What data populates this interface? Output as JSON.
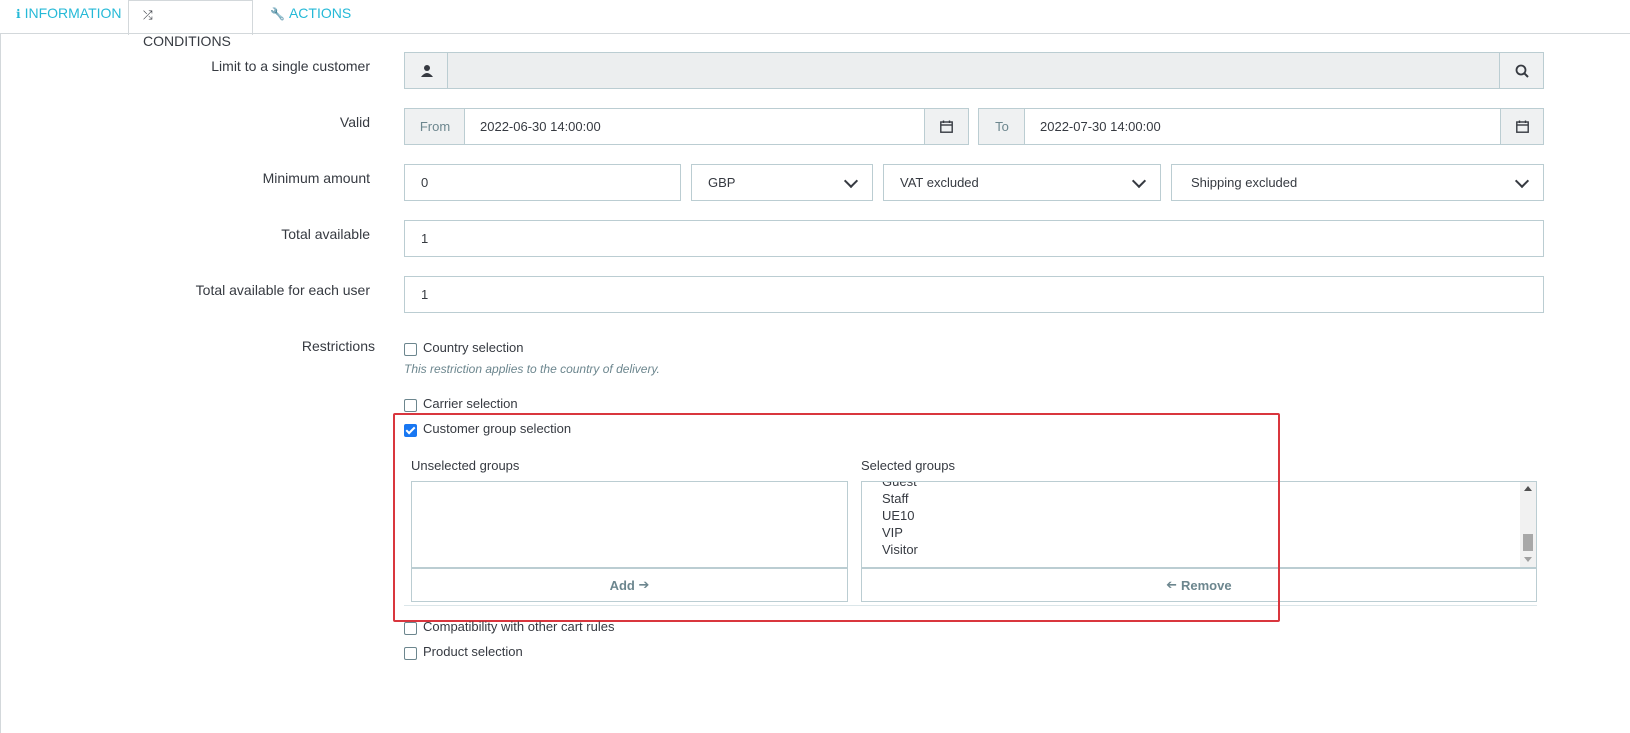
{
  "tabs": [
    {
      "label": "INFORMATION",
      "icon": "info-icon"
    },
    {
      "label": "CONDITIONS",
      "icon": "shuffle-icon"
    },
    {
      "label": "ACTIONS",
      "icon": "wrench-icon"
    }
  ],
  "form": {
    "customer_label": "Limit to a single customer",
    "valid_label": "Valid",
    "from_label": "From",
    "from_value": "2022-06-30 14:00:00",
    "to_label": "To",
    "to_value": "2022-07-30 14:00:00",
    "min_amount_label": "Minimum amount",
    "min_amount_value": "0",
    "currency_value": "GBP",
    "tax_value": "VAT excluded",
    "shipping_value": "Shipping excluded",
    "total_available_label": "Total available",
    "total_available_value": "1",
    "total_each_user_label": "Total available for each user",
    "total_each_user_value": "1",
    "restrictions_label": "Restrictions"
  },
  "restrictions": {
    "country": "Country selection",
    "country_help": "This restriction applies to the country of delivery.",
    "carrier": "Carrier selection",
    "customer_group": "Customer group selection",
    "unselected_label": "Unselected groups",
    "selected_label": "Selected groups",
    "selected_items": [
      "Guest",
      "Staff",
      "UE10",
      "VIP",
      "Visitor"
    ],
    "add_label": "Add",
    "remove_label": "Remove",
    "compatibility": "Compatibility with other cart rules",
    "product": "Product selection"
  },
  "colors": {
    "accent": "#25b9d7",
    "highlight": "#d9363e",
    "checkbox": "#1877f2"
  }
}
